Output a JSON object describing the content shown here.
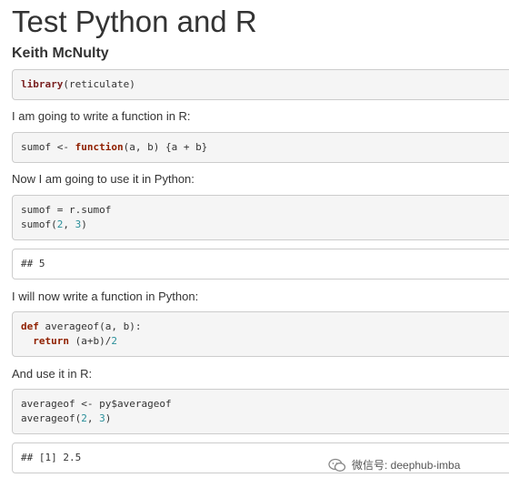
{
  "header": {
    "title": "Test Python and R",
    "author": "Keith McNulty"
  },
  "blocks": [
    {
      "kind": "code",
      "lines": [
        {
          "fn": "library",
          "rest": "(reticulate)"
        }
      ]
    },
    {
      "kind": "text",
      "text": "I am going to write a function in R:"
    },
    {
      "kind": "code",
      "lines": [
        {
          "pre": "sumof <- ",
          "kw": "function",
          "rest": "(a, b) {a + b}"
        }
      ]
    },
    {
      "kind": "text",
      "text": "Now I am going to use it in Python:"
    },
    {
      "kind": "code",
      "lines": [
        {
          "pre": "sumof = r.sumof"
        },
        {
          "pre": "sumof(",
          "n1": "2",
          "mid": ", ",
          "n2": "3",
          "rest": ")"
        }
      ]
    },
    {
      "kind": "output",
      "lines": [
        {
          "pre": "## 5"
        }
      ]
    },
    {
      "kind": "text",
      "text": "I will now write a function in Python:"
    },
    {
      "kind": "code",
      "lines": [
        {
          "kw": "def",
          "rest": " averageof(a, b):"
        },
        {
          "indent": "  ",
          "kw": "return",
          "rest": " (a+b)/",
          "n1": "2"
        }
      ]
    },
    {
      "kind": "text",
      "text": "And use it in R:"
    },
    {
      "kind": "code",
      "lines": [
        {
          "pre": "averageof <- py$averageof"
        },
        {
          "pre": "averageof(",
          "n1": "2",
          "mid": ", ",
          "n2": "3",
          "rest": ")"
        }
      ]
    },
    {
      "kind": "output",
      "lines": [
        {
          "pre": "## [1] 2.5"
        }
      ]
    }
  ],
  "watermark": {
    "icon": "wechat-icon",
    "text": "微信号: deephub-imba"
  },
  "colors": {
    "keyword": "#902000",
    "number": "#2a8f9a",
    "code_bg": "#f5f5f5",
    "border": "#cccccc"
  }
}
